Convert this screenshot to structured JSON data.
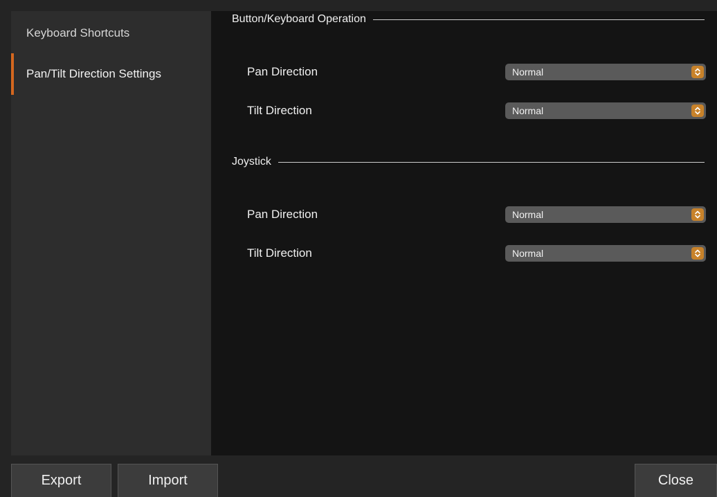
{
  "sidebar": {
    "items": [
      {
        "label": "Keyboard Shortcuts",
        "active": false
      },
      {
        "label": "Pan/Tilt Direction Settings",
        "active": true
      }
    ]
  },
  "sections": [
    {
      "title": "Button/Keyboard Operation",
      "rows": [
        {
          "label": "Pan Direction",
          "value": "Normal"
        },
        {
          "label": "Tilt Direction",
          "value": "Normal"
        }
      ]
    },
    {
      "title": "Joystick",
      "rows": [
        {
          "label": "Pan Direction",
          "value": "Normal"
        },
        {
          "label": "Tilt Direction",
          "value": "Normal"
        }
      ]
    }
  ],
  "footer": {
    "export_label": "Export",
    "import_label": "Import",
    "close_label": "Close"
  },
  "colors": {
    "accent": "#d4671f",
    "stepper": "#c8822a"
  },
  "icons": {
    "select_stepper": "up-down-chevron-icon"
  }
}
